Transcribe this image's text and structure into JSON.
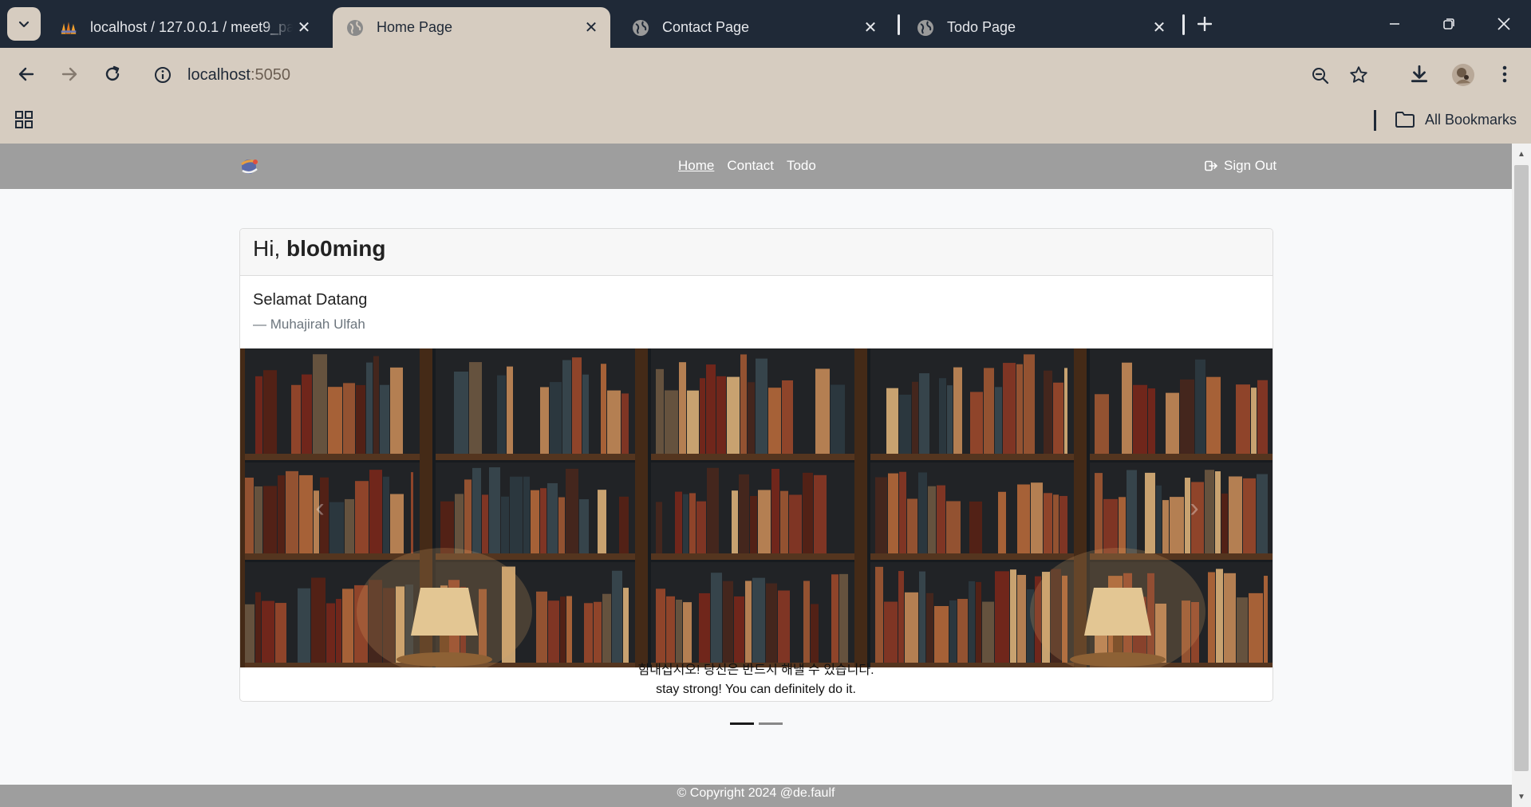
{
  "browser": {
    "tabs": [
      {
        "title": "localhost / 127.0.0.1 / meet9_pa",
        "favicon": "phpmyadmin-icon",
        "active": false
      },
      {
        "title": "Home Page",
        "favicon": "globe-icon",
        "active": true
      },
      {
        "title": "Contact Page",
        "favicon": "globe-icon",
        "active": false
      },
      {
        "title": "Todo Page",
        "favicon": "globe-icon",
        "active": false
      }
    ],
    "url_host": "localhost",
    "url_port": ":5050",
    "bookmarks_label": "All Bookmarks",
    "accent_color": "#d6ccc0",
    "tabstrip_color": "#1f2937"
  },
  "navbar": {
    "links": [
      "Home",
      "Contact",
      "Todo"
    ],
    "active_link": "Home",
    "signout_label": "Sign Out"
  },
  "card": {
    "greeting": "Hi,",
    "username": "blo0ming",
    "quote_text": "Selamat Datang",
    "quote_author": "— Muhajirah Ulfah"
  },
  "carousel": {
    "caption_line1": "힘내십시오! 당신은 반드시 해낼 수 있습니다.",
    "caption_line2": "stay strong! You can definitely do it.",
    "slide_count": 2,
    "active_slide": 1,
    "image": "bookshelf-library-image"
  },
  "footer": {
    "text": "© Copyright 2024 @de.faulf"
  }
}
